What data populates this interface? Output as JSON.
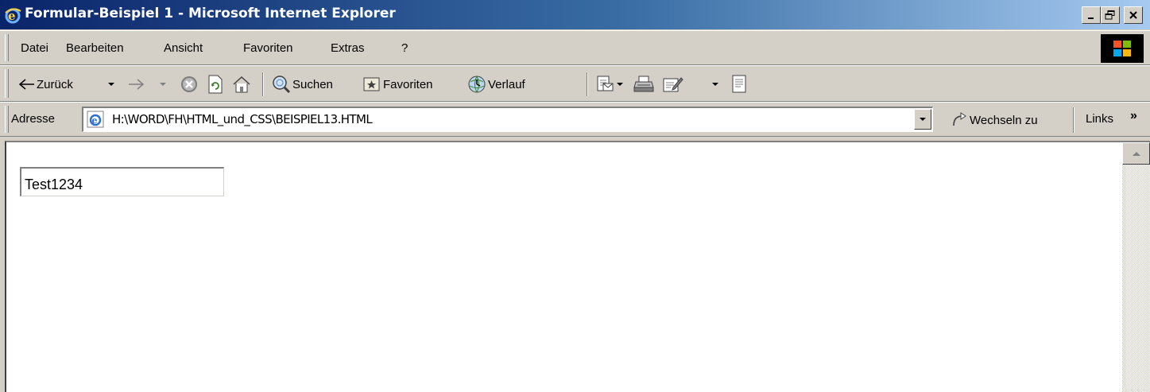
{
  "window": {
    "title": "Formular-Beispiel 1 - Microsoft Internet Explorer",
    "buttons": [
      "minimize",
      "restore",
      "close"
    ]
  },
  "menubar": {
    "items": [
      "Datei",
      "Bearbeiten",
      "Ansicht",
      "Favoriten",
      "Extras",
      "?"
    ]
  },
  "toolbar": {
    "back_label": "Zurück",
    "search_label": "Suchen",
    "favorites_label": "Favoriten",
    "history_label": "Verlauf"
  },
  "addressbar": {
    "label": "Adresse",
    "url": "H:\\WORD\\FH\\HTML_und_CSS\\BEISPIEL13.HTML",
    "go_label": "Wechseln zu",
    "links_label": "Links",
    "links_chevron": "»"
  },
  "page": {
    "text_input_value": "Test1234"
  },
  "colors": {
    "titlebar_start": "#0a246a",
    "titlebar_end": "#a6caf0",
    "chrome": "#d4d0c8"
  }
}
